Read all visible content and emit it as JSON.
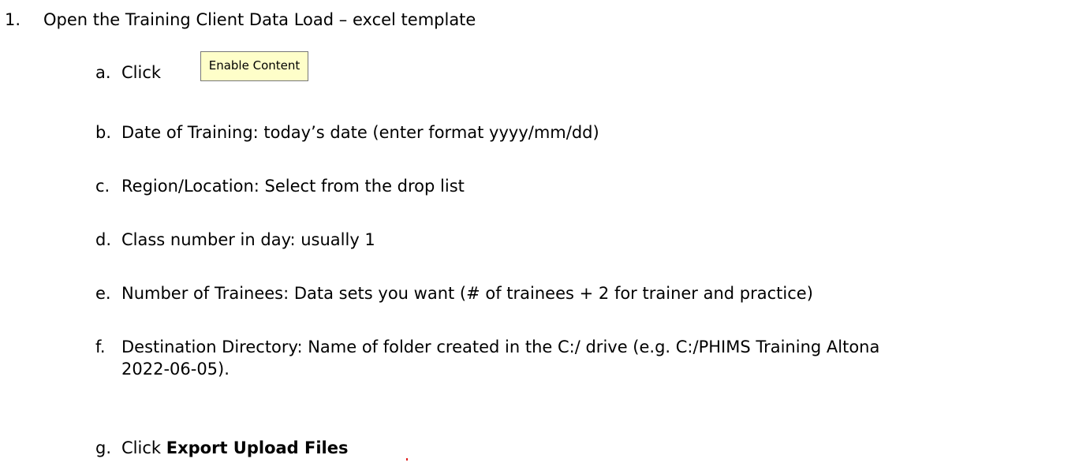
{
  "step": {
    "number": "1.",
    "text": "Open the Training Client Data Load – excel template"
  },
  "substeps": {
    "a": {
      "letter": "a.",
      "text": "Click",
      "button_label": "Enable Content"
    },
    "b": {
      "letter": "b.",
      "text": "Date of Training: today’s date (enter format yyyy/mm/dd)"
    },
    "c": {
      "letter": "c.",
      "text": "Region/Location: Select from the drop list"
    },
    "d": {
      "letter": "d.",
      "text": "Class number in day: usually 1"
    },
    "e": {
      "letter": "e.",
      "text": "Number of Trainees: Data sets you  want (# of trainees + 2 for trainer and practice)"
    },
    "f": {
      "letter": "f.",
      "text_line1": "Destination Directory: Name of folder created in the C:/ drive  (e.g. C:/PHIMS Training Altona",
      "text_line2": "2022-06-05)."
    },
    "g": {
      "letter": "g.",
      "text": "Click",
      "bold_text": "Export Upload Files"
    }
  }
}
